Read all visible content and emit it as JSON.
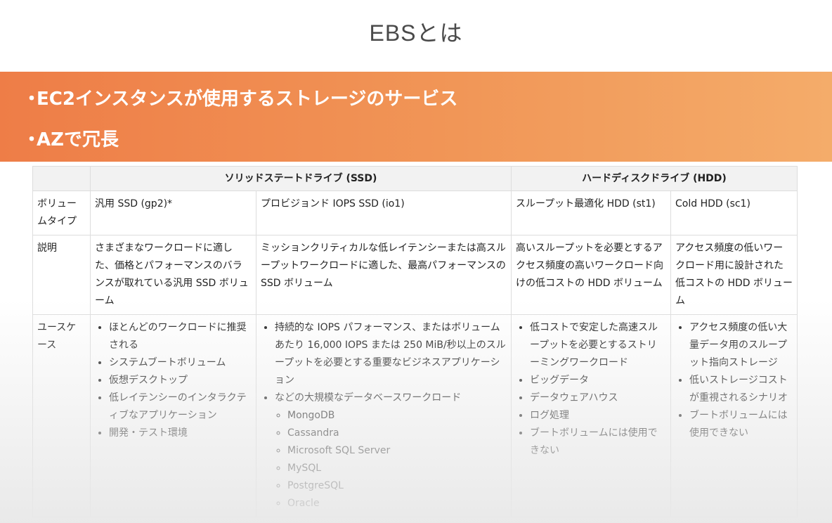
{
  "title": "EBSとは",
  "banner": {
    "bullet_char": "・",
    "bullets": [
      "EC2インスタンスが使用するストレージのサービス",
      "AZで冗長"
    ]
  },
  "table": {
    "groups": [
      "ソリッドステートドライブ (SSD)",
      "ハードディスクドライブ (HDD)"
    ],
    "row_headers": {
      "volume_type": "ボリュームタイプ",
      "description": "説明",
      "use_cases": "ユースケース"
    },
    "columns": [
      {
        "type": "汎用 SSD (gp2)*",
        "description": "さまざまなワークロードに適した、価格とパフォーマンスのバランスが取れている汎用 SSD ボリューム",
        "use_cases": [
          "ほとんどのワークロードに推奨される",
          "システムブートボリューム",
          "仮想デスクトップ",
          "低レイテンシーのインタラクティブなアプリケーション",
          "開発・テスト環境"
        ]
      },
      {
        "type": "プロビジョンド IOPS SSD (io1)",
        "description": "ミッションクリティカルな低レイテンシーまたは高スループットワークロードに適した、最高パフォーマンスの SSD ボリューム",
        "use_cases": [
          "持続的な IOPS パフォーマンス、またはボリュームあたり 16,000 IOPS または 250 MiB/秒以上のスループットを必要とする重要なビジネスアプリケーション",
          "などの大規模なデータベースワークロード"
        ],
        "sub_items": [
          "MongoDB",
          "Cassandra",
          "Microsoft SQL Server",
          "MySQL",
          "PostgreSQL",
          "Oracle"
        ]
      },
      {
        "type": "スループット最適化 HDD (st1)",
        "description": "高いスループットを必要とするアクセス頻度の高いワークロード向けの低コストの HDD ボリューム",
        "use_cases": [
          "低コストで安定した高速スループットを必要とするストリーミングワークロード",
          "ビッグデータ",
          "データウェアハウス",
          "ログ処理",
          "ブートボリュームには使用できない"
        ]
      },
      {
        "type": "Cold HDD (sc1)",
        "description": "アクセス頻度の低いワークロード用に設計された低コストの HDD ボリューム",
        "use_cases": [
          "アクセス頻度の低い大量データ用のスループット指向ストレージ",
          "低いストレージコストが重視されるシナリオ",
          "ブートボリュームには使用できない"
        ]
      }
    ]
  }
}
